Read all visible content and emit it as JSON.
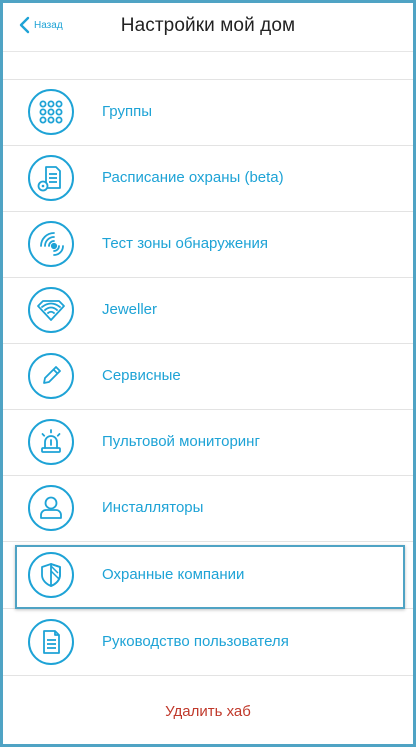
{
  "header": {
    "back_label": "Назад",
    "title": "Настройки мой дом"
  },
  "menu": {
    "items": [
      {
        "icon": "partial-icon",
        "label": ""
      },
      {
        "icon": "grid-dots-icon",
        "label": "Группы"
      },
      {
        "icon": "schedule-document-icon",
        "label": "Расписание охраны (beta)"
      },
      {
        "icon": "signal-waves-icon",
        "label": "Тест зоны обнаружения"
      },
      {
        "icon": "wifi-diamond-icon",
        "label": "Jeweller"
      },
      {
        "icon": "pencil-icon",
        "label": "Сервисные"
      },
      {
        "icon": "siren-icon",
        "label": "Пультовой мониторинг"
      },
      {
        "icon": "user-icon",
        "label": "Инсталляторы"
      },
      {
        "icon": "shield-icon",
        "label": "Охранные компании"
      },
      {
        "icon": "document-icon",
        "label": "Руководство пользователя"
      }
    ]
  },
  "delete_hub_label": "Удалить хаб",
  "colors": {
    "accent": "#1ea3d6",
    "danger": "#c0392b",
    "frame": "#4fa3c4"
  }
}
